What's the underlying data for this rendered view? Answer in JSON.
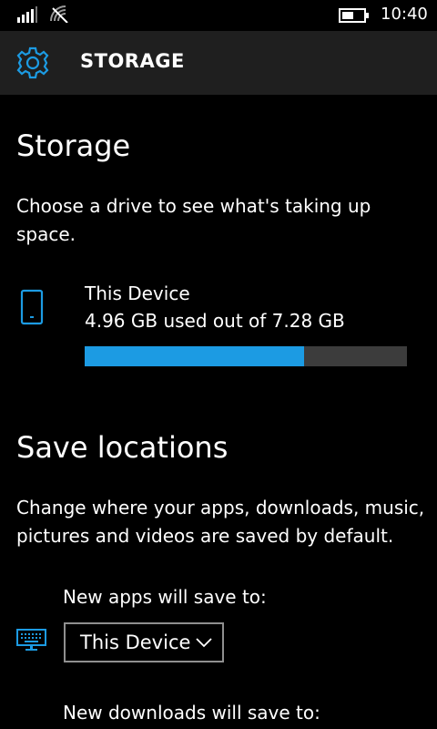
{
  "status_bar": {
    "time": "10:40"
  },
  "header": {
    "title": "STORAGE"
  },
  "storage": {
    "heading": "Storage",
    "description": "Choose a drive to see what's taking up space.",
    "device_name": "This Device",
    "usage_text": "4.96 GB used out of 7.28 GB",
    "used_gb": 4.96,
    "total_gb": 7.28
  },
  "save_locations": {
    "heading": "Save locations",
    "description": "Change where your apps, downloads, music, pictures and videos are saved by default.",
    "apps_label": "New apps will save to:",
    "apps_selected": "This Device",
    "downloads_label": "New downloads will save to:"
  },
  "colors": {
    "accent": "#1c9be3",
    "background": "#000000",
    "header_bg": "#1f1f1f"
  },
  "icons": {
    "settings": "gear-icon",
    "device": "phone-icon",
    "apps": "keyboard-icon"
  }
}
